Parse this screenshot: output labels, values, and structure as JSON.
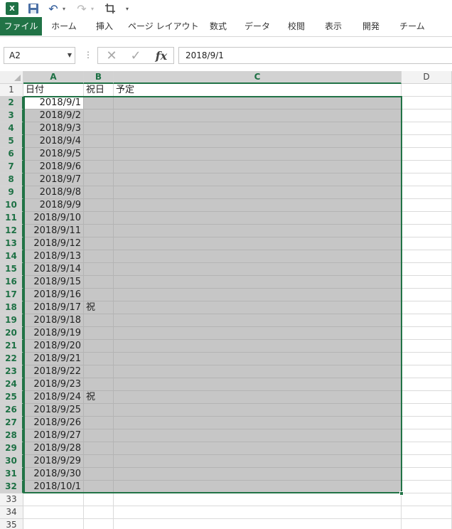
{
  "qat": {
    "logo_text": "X",
    "icons": [
      "excel-logo-icon",
      "save-icon",
      "undo-icon",
      "redo-icon",
      "crop-icon",
      "customize-icon"
    ]
  },
  "ribbon": {
    "tabs": [
      "ファイル",
      "ホーム",
      "挿入",
      "ページ レイアウト",
      "数式",
      "データ",
      "校閲",
      "表示",
      "開発",
      "チーム"
    ]
  },
  "formula_bar": {
    "name_box": "A2",
    "formula": "2018/9/1",
    "fx_label": "fx"
  },
  "columns": [
    "A",
    "B",
    "C",
    "D"
  ],
  "selected_columns": [
    "A",
    "B",
    "C"
  ],
  "header_row": {
    "A": "日付",
    "B": "祝日",
    "C": "予定"
  },
  "rows": [
    {
      "n": "1"
    },
    {
      "n": "2",
      "A": "2018/9/1",
      "B": ""
    },
    {
      "n": "3",
      "A": "2018/9/2",
      "B": ""
    },
    {
      "n": "4",
      "A": "2018/9/3",
      "B": ""
    },
    {
      "n": "5",
      "A": "2018/9/4",
      "B": ""
    },
    {
      "n": "6",
      "A": "2018/9/5",
      "B": ""
    },
    {
      "n": "7",
      "A": "2018/9/6",
      "B": ""
    },
    {
      "n": "8",
      "A": "2018/9/7",
      "B": ""
    },
    {
      "n": "9",
      "A": "2018/9/8",
      "B": ""
    },
    {
      "n": "10",
      "A": "2018/9/9",
      "B": ""
    },
    {
      "n": "11",
      "A": "2018/9/10",
      "B": ""
    },
    {
      "n": "12",
      "A": "2018/9/11",
      "B": ""
    },
    {
      "n": "13",
      "A": "2018/9/12",
      "B": ""
    },
    {
      "n": "14",
      "A": "2018/9/13",
      "B": ""
    },
    {
      "n": "15",
      "A": "2018/9/14",
      "B": ""
    },
    {
      "n": "16",
      "A": "2018/9/15",
      "B": ""
    },
    {
      "n": "17",
      "A": "2018/9/16",
      "B": ""
    },
    {
      "n": "18",
      "A": "2018/9/17",
      "B": "祝"
    },
    {
      "n": "19",
      "A": "2018/9/18",
      "B": ""
    },
    {
      "n": "20",
      "A": "2018/9/19",
      "B": ""
    },
    {
      "n": "21",
      "A": "2018/9/20",
      "B": ""
    },
    {
      "n": "22",
      "A": "2018/9/21",
      "B": ""
    },
    {
      "n": "23",
      "A": "2018/9/22",
      "B": ""
    },
    {
      "n": "24",
      "A": "2018/9/23",
      "B": ""
    },
    {
      "n": "25",
      "A": "2018/9/24",
      "B": "祝"
    },
    {
      "n": "26",
      "A": "2018/9/25",
      "B": ""
    },
    {
      "n": "27",
      "A": "2018/9/26",
      "B": ""
    },
    {
      "n": "28",
      "A": "2018/9/27",
      "B": ""
    },
    {
      "n": "29",
      "A": "2018/9/28",
      "B": ""
    },
    {
      "n": "30",
      "A": "2018/9/29",
      "B": ""
    },
    {
      "n": "31",
      "A": "2018/9/30",
      "B": ""
    },
    {
      "n": "32",
      "A": "2018/10/1",
      "B": ""
    },
    {
      "n": "33"
    },
    {
      "n": "34"
    },
    {
      "n": "35"
    }
  ],
  "colors": {
    "accent": "#217346",
    "selection": "#c6c6c6"
  }
}
